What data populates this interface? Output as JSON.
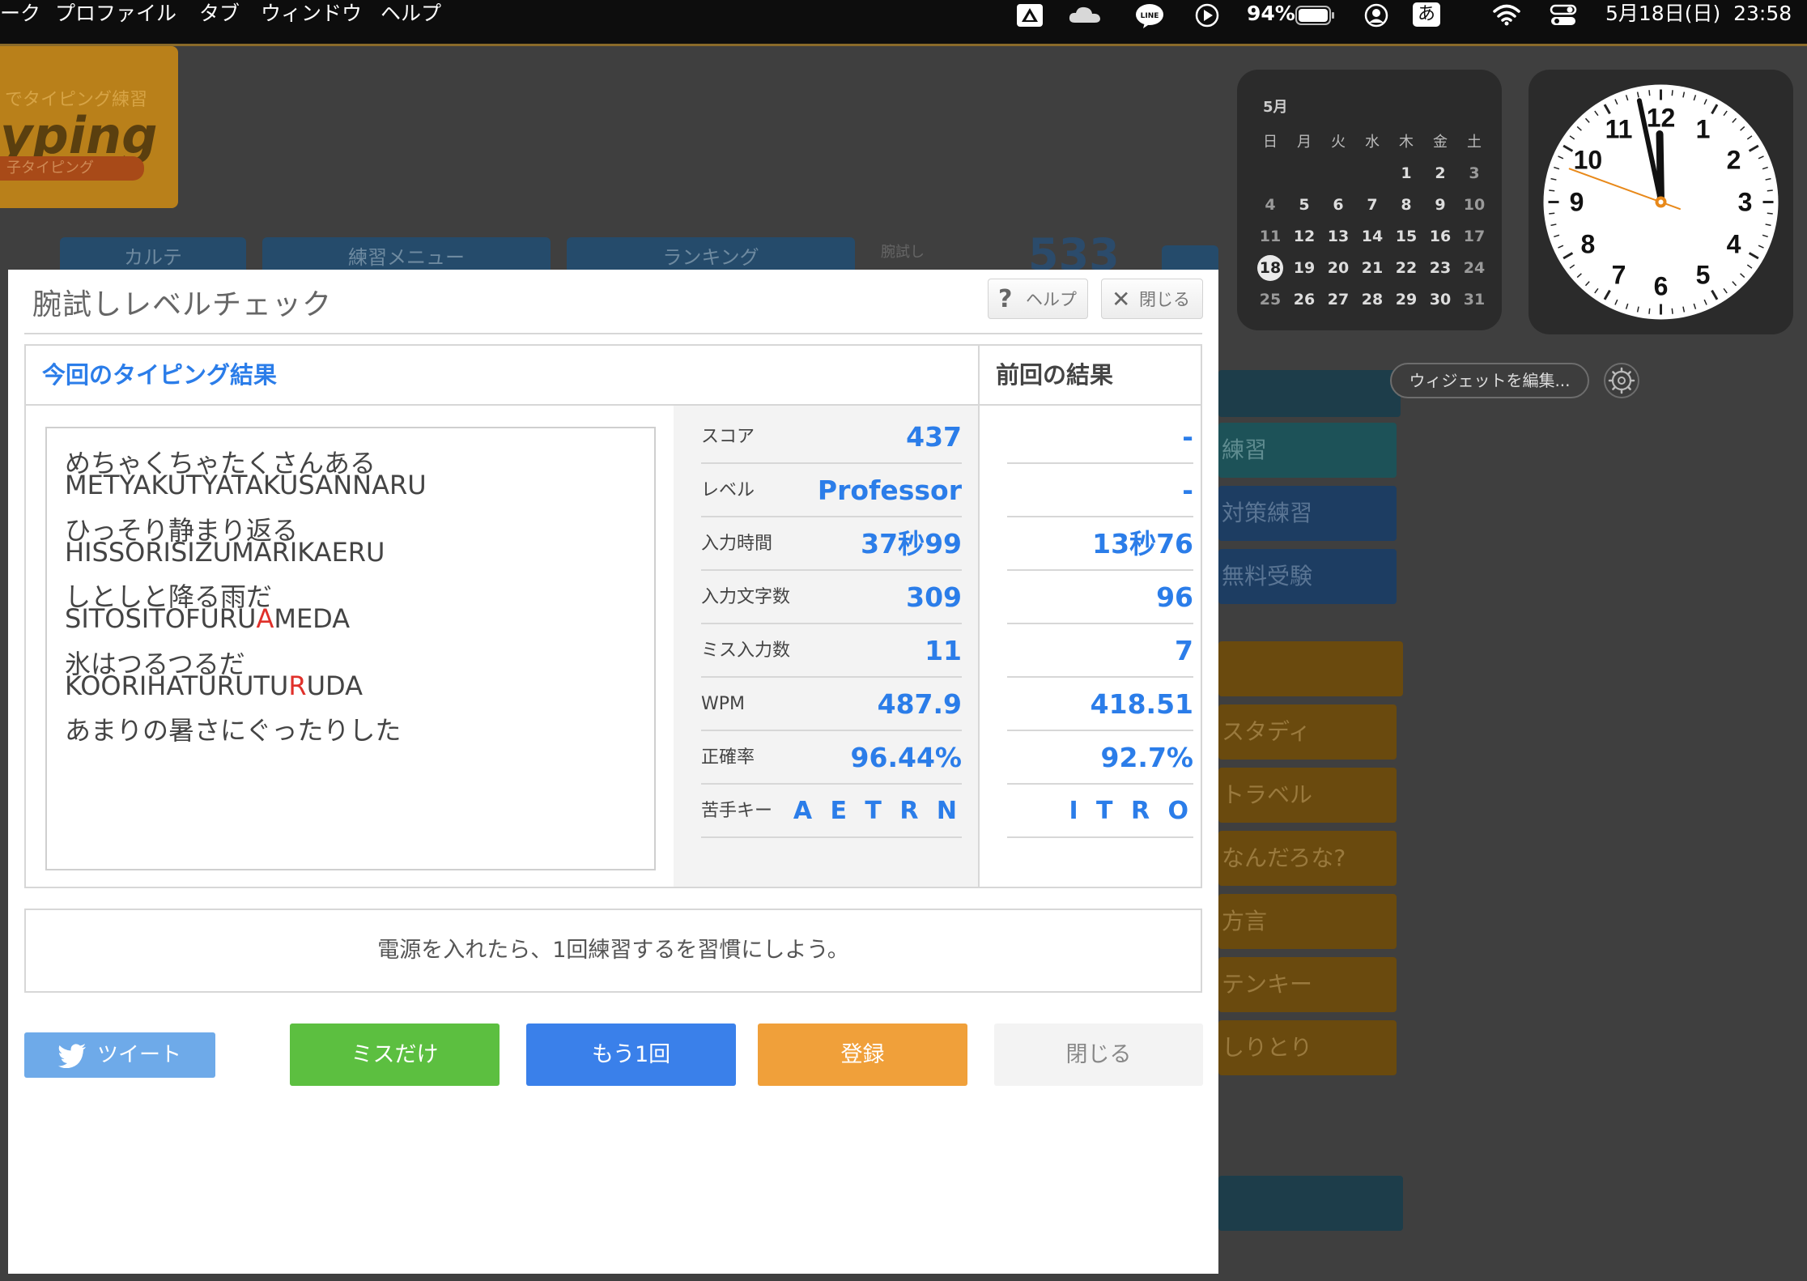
{
  "menubar": {
    "menus": [
      "ーク",
      "プロファイル",
      "タブ",
      "ウィンドウ",
      "ヘルプ"
    ],
    "battery_percent": "94%",
    "ime_label": "あ",
    "datetime": "5月18日(日)  23:58",
    "icons": [
      "drive-icon",
      "cloud-icon",
      "line-icon",
      "play-icon",
      "battery-icon",
      "user-icon",
      "ime-icon",
      "wifi-icon",
      "control-center-icon"
    ]
  },
  "background_page": {
    "logo_line1": "でタイピング練習",
    "logo_line2": "yping",
    "logo_line3": "子タイピング",
    "nav_tabs": [
      "カルテ",
      "練習メニュー",
      "ランキング"
    ],
    "score_peek_label": "腕試し",
    "score_peek_value": "533",
    "side_items": [
      "練習",
      "対策練習",
      "無料受験",
      "スタディ",
      "トラベル",
      "なんだろな?",
      "方言",
      "テンキー",
      "しりとり"
    ]
  },
  "calendar_widget": {
    "month": "5月",
    "weekdays": [
      "日",
      "月",
      "火",
      "水",
      "木",
      "金",
      "土"
    ],
    "weeks": [
      [
        "",
        "",
        "",
        "",
        "1",
        "2",
        "3"
      ],
      [
        "4",
        "5",
        "6",
        "7",
        "8",
        "9",
        "10"
      ],
      [
        "11",
        "12",
        "13",
        "14",
        "15",
        "16",
        "17"
      ],
      [
        "18",
        "19",
        "20",
        "21",
        "22",
        "23",
        "24"
      ],
      [
        "25",
        "26",
        "27",
        "28",
        "29",
        "30",
        "31"
      ]
    ],
    "today": "18"
  },
  "clock_widget": {
    "numerals": [
      "12",
      "1",
      "2",
      "3",
      "4",
      "5",
      "6",
      "7",
      "8",
      "9",
      "10",
      "11"
    ],
    "time": "23:58"
  },
  "widget_controls": {
    "edit_label": "ウィジェットを編集..."
  },
  "modal": {
    "title": "腕試しレベルチェック",
    "help_label": "ヘルプ",
    "close_label": "閉じる",
    "current_heading": "今回のタイピング結果",
    "previous_heading": "前回の結果",
    "typed_lines": [
      {
        "jp": "めちゃくちゃたくさんある",
        "romaji_before": "METYAKUTYATAKUSANNARU",
        "miss": "",
        "romaji_after": ""
      },
      {
        "jp": "ひっそり静まり返る",
        "romaji_before": "HISSORISIZUMARIKAERU",
        "miss": "",
        "romaji_after": ""
      },
      {
        "jp": "しとしと降る雨だ",
        "romaji_before": "SITOSITOFURU",
        "miss": "A",
        "romaji_after": "MEDA"
      },
      {
        "jp": "氷はつるつるだ",
        "romaji_before": "KOORIHATURUTU",
        "miss": "R",
        "romaji_after": "UDA"
      },
      {
        "jp": "あまりの暑さにぐったりした",
        "romaji_before": "",
        "miss": "",
        "romaji_after": ""
      }
    ],
    "stats": [
      {
        "label": "スコア",
        "current": "437",
        "previous": "-"
      },
      {
        "label": "レベル",
        "current": "Professor",
        "previous": "-"
      },
      {
        "label": "入力時間",
        "current": "37秒99",
        "previous": "13秒76"
      },
      {
        "label": "入力文字数",
        "current": "309",
        "previous": "96"
      },
      {
        "label": "ミス入力数",
        "current": "11",
        "previous": "7"
      },
      {
        "label": "WPM",
        "current": "487.9",
        "previous": "418.51"
      },
      {
        "label": "正確率",
        "current": "96.44%",
        "previous": "92.7%"
      },
      {
        "label": "苦手キー",
        "current": "A E T R N",
        "previous": "I T R O"
      }
    ],
    "message": "電源を入れたら、1回練習するを習慣にしよう。",
    "buttons": {
      "tweet": "ツイート",
      "miss_only": "ミスだけ",
      "retry": "もう1回",
      "register": "登録",
      "close": "閉じる"
    }
  },
  "colors": {
    "accent_blue": "#2b7de9",
    "miss_red": "#e0302a",
    "green": "#5cbf40",
    "blue_button": "#3a80ea",
    "orange": "#f0a03a",
    "tweet_blue": "#6eaae9"
  }
}
